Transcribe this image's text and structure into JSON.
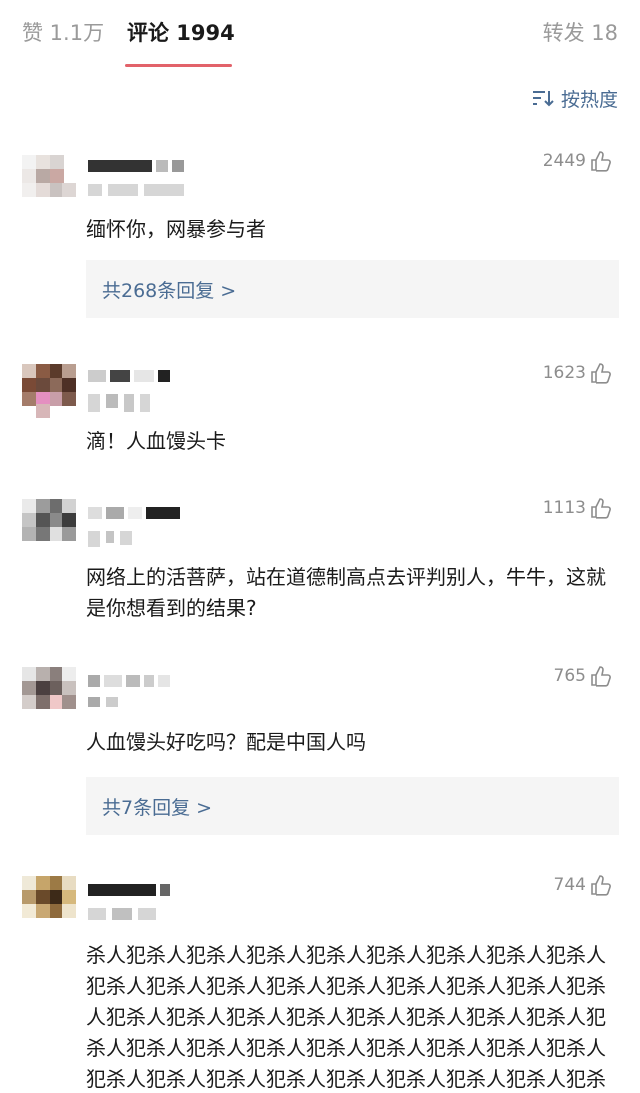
{
  "tabs": {
    "likes_tab": "赞 1.1万",
    "comments_tab": "评论 1994",
    "reposts_tab": "转发 18"
  },
  "sort": {
    "label": "按热度",
    "icon": "sort-icon"
  },
  "colors": {
    "accent_underline": "#e2626a",
    "link_blue": "#4a6c93",
    "muted_gray": "#9a9a9a"
  },
  "comments": [
    {
      "likes": "2449",
      "text": "缅怀你，网暴参与者",
      "replies": "共268条回复 >"
    },
    {
      "likes": "1623",
      "text": "滴！人血馒头卡",
      "replies": ""
    },
    {
      "likes": "1113",
      "text": "网络上的活菩萨，站在道德制高点去评判别人，牛牛，这就是你想看到的结果?",
      "replies": ""
    },
    {
      "likes": "765",
      "text": "人血馒头好吃吗？配是中国人吗",
      "replies": "共7条回复 >"
    },
    {
      "likes": "744",
      "text": "杀人犯杀人犯杀人犯杀人犯杀人犯杀人犯杀人犯杀人犯杀人犯杀人犯杀人犯杀人犯杀人犯杀人犯杀人犯杀人犯杀人犯杀人犯杀人犯杀人犯杀人犯杀人犯杀人犯杀人犯杀人犯杀人犯杀人犯杀人犯杀人犯杀人犯杀人犯杀人犯杀人犯杀人犯杀人犯杀人犯杀人犯杀人犯杀人犯杀人犯杀人犯杀人犯杀人犯杀人犯杀人犯杀",
      "replies": ""
    }
  ]
}
